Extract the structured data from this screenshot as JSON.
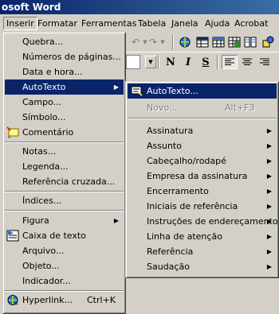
{
  "window": {
    "title": "osoft Word"
  },
  "menubar": {
    "items": [
      {
        "label": "Inserir"
      },
      {
        "label": "Formatar"
      },
      {
        "label": "Ferramentas"
      },
      {
        "label": "Tabela"
      },
      {
        "label": "Janela"
      },
      {
        "label": "Ajuda"
      },
      {
        "label": "Acrobat"
      }
    ]
  },
  "toolbar": {
    "bold": "N",
    "italic": "I",
    "underline": "S"
  },
  "insert_menu": {
    "quebra": "Quebra...",
    "numeros": "Números de páginas...",
    "data_hora": "Data e hora...",
    "autotexto": "AutoTexto",
    "campo": "Campo...",
    "simbolo": "Símbolo...",
    "comentario": "Comentário",
    "notas": "Notas...",
    "legenda": "Legenda...",
    "referencia": "Referência cruzada...",
    "indices": "Índices...",
    "figura": "Figura",
    "caixa": "Caixa de texto",
    "arquivo": "Arquivo...",
    "objeto": "Objeto...",
    "indicador": "Indicador...",
    "hyperlink": "Hyperlink...",
    "hyperlink_shortcut": "Ctrl+K"
  },
  "autotext_submenu": {
    "autotexto": "AutoTexto...",
    "novo": "Novo...",
    "novo_shortcut": "Alt+F3",
    "items": [
      {
        "label": "Assinatura"
      },
      {
        "label": "Assunto"
      },
      {
        "label": "Cabeçalho/rodapé"
      },
      {
        "label": "Empresa da assinatura"
      },
      {
        "label": "Encerramento"
      },
      {
        "label": "Iniciais de referência"
      },
      {
        "label": "Instruções de endereçamento"
      },
      {
        "label": "Linha de atenção"
      },
      {
        "label": "Referência"
      },
      {
        "label": "Saudação"
      }
    ]
  },
  "colors": {
    "highlight": "#0a246a",
    "face": "#d4d0c8",
    "disabled": "#808080"
  }
}
